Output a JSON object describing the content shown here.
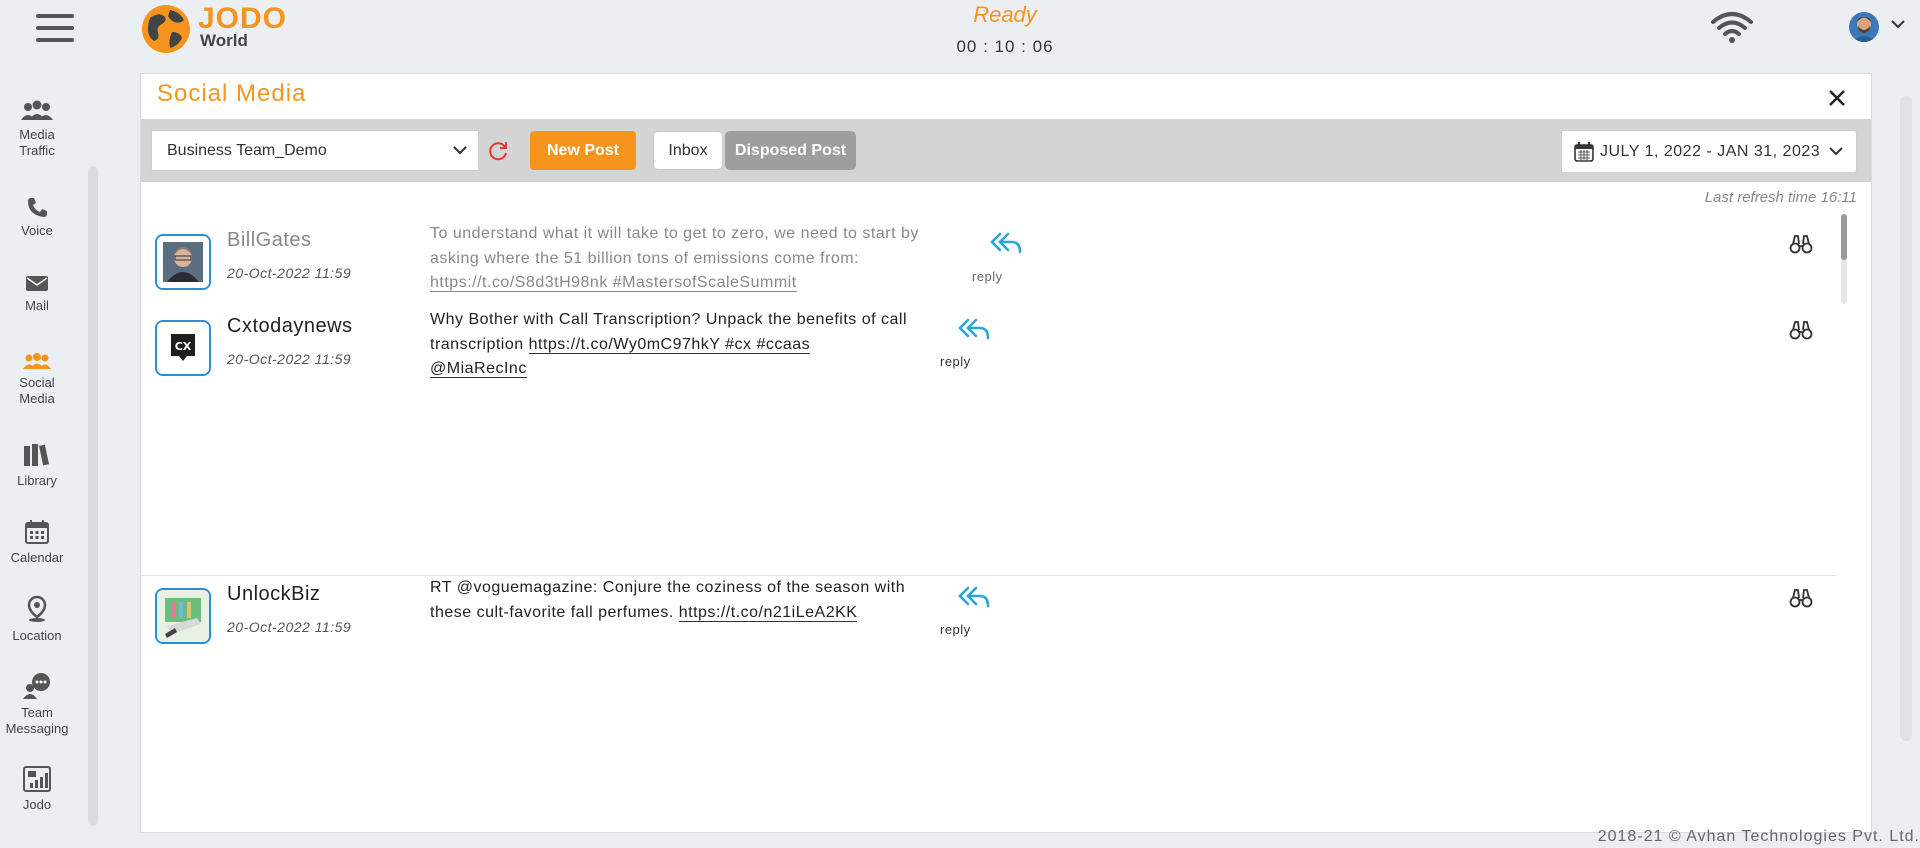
{
  "header": {
    "logo_top": "JODO",
    "logo_bottom": "World",
    "status": "Ready",
    "timer": "00 : 10 : 06"
  },
  "sidebar": {
    "items": [
      {
        "label": "Media Traffic",
        "icon": "media-traffic-icon"
      },
      {
        "label": "Voice",
        "icon": "phone-icon"
      },
      {
        "label": "Mail",
        "icon": "mail-icon"
      },
      {
        "label": "Social Media",
        "icon": "users-icon"
      },
      {
        "label": "Library",
        "icon": "library-icon"
      },
      {
        "label": "Calendar",
        "icon": "calendar-icon"
      },
      {
        "label": "Location",
        "icon": "location-icon"
      },
      {
        "label": "Team Messaging",
        "icon": "chat-icon"
      },
      {
        "label": "Jodo",
        "icon": "report-icon"
      }
    ]
  },
  "panel": {
    "title": "Social Media",
    "team_select": "Business Team_Demo",
    "new_post": "New Post",
    "inbox": "Inbox",
    "disposed": "Disposed Post",
    "date_range": "JULY 1, 2022 - JAN 31, 2023",
    "last_refresh": "Last refresh time 16:11"
  },
  "posts": [
    {
      "name": "BillGates",
      "time": "20-Oct-2022 11:59",
      "text": "To understand what it will take to get to zero, we need to start by asking where the 51 billion tons of emissions come from:",
      "link": "https://t.co/S8d3tH98nk #MastersofScaleSummit",
      "reply": "reply"
    },
    {
      "name": "Cxtodaynews",
      "time": "20-Oct-2022 11:59",
      "text": "Why Bother with Call Transcription? Unpack the benefits of call transcription",
      "link": "https://t.co/Wy0mC97hkY #cx #ccaas",
      "link2": "@MiaRecInc",
      "reply": "reply"
    },
    {
      "name": "UnlockBiz",
      "time": "20-Oct-2022 11:59",
      "text": "RT @voguemagazine: Conjure the coziness of the season with these cult-favorite fall perfumes.",
      "link": "https://t.co/n21iLeA2KK",
      "reply": "reply"
    }
  ],
  "footer": "2018-21 © Avhan Technologies Pvt. Ltd.",
  "colors": {
    "accent": "#f7941d",
    "reply": "#2aa7d6",
    "avatar_border": "#2a8fd6"
  }
}
